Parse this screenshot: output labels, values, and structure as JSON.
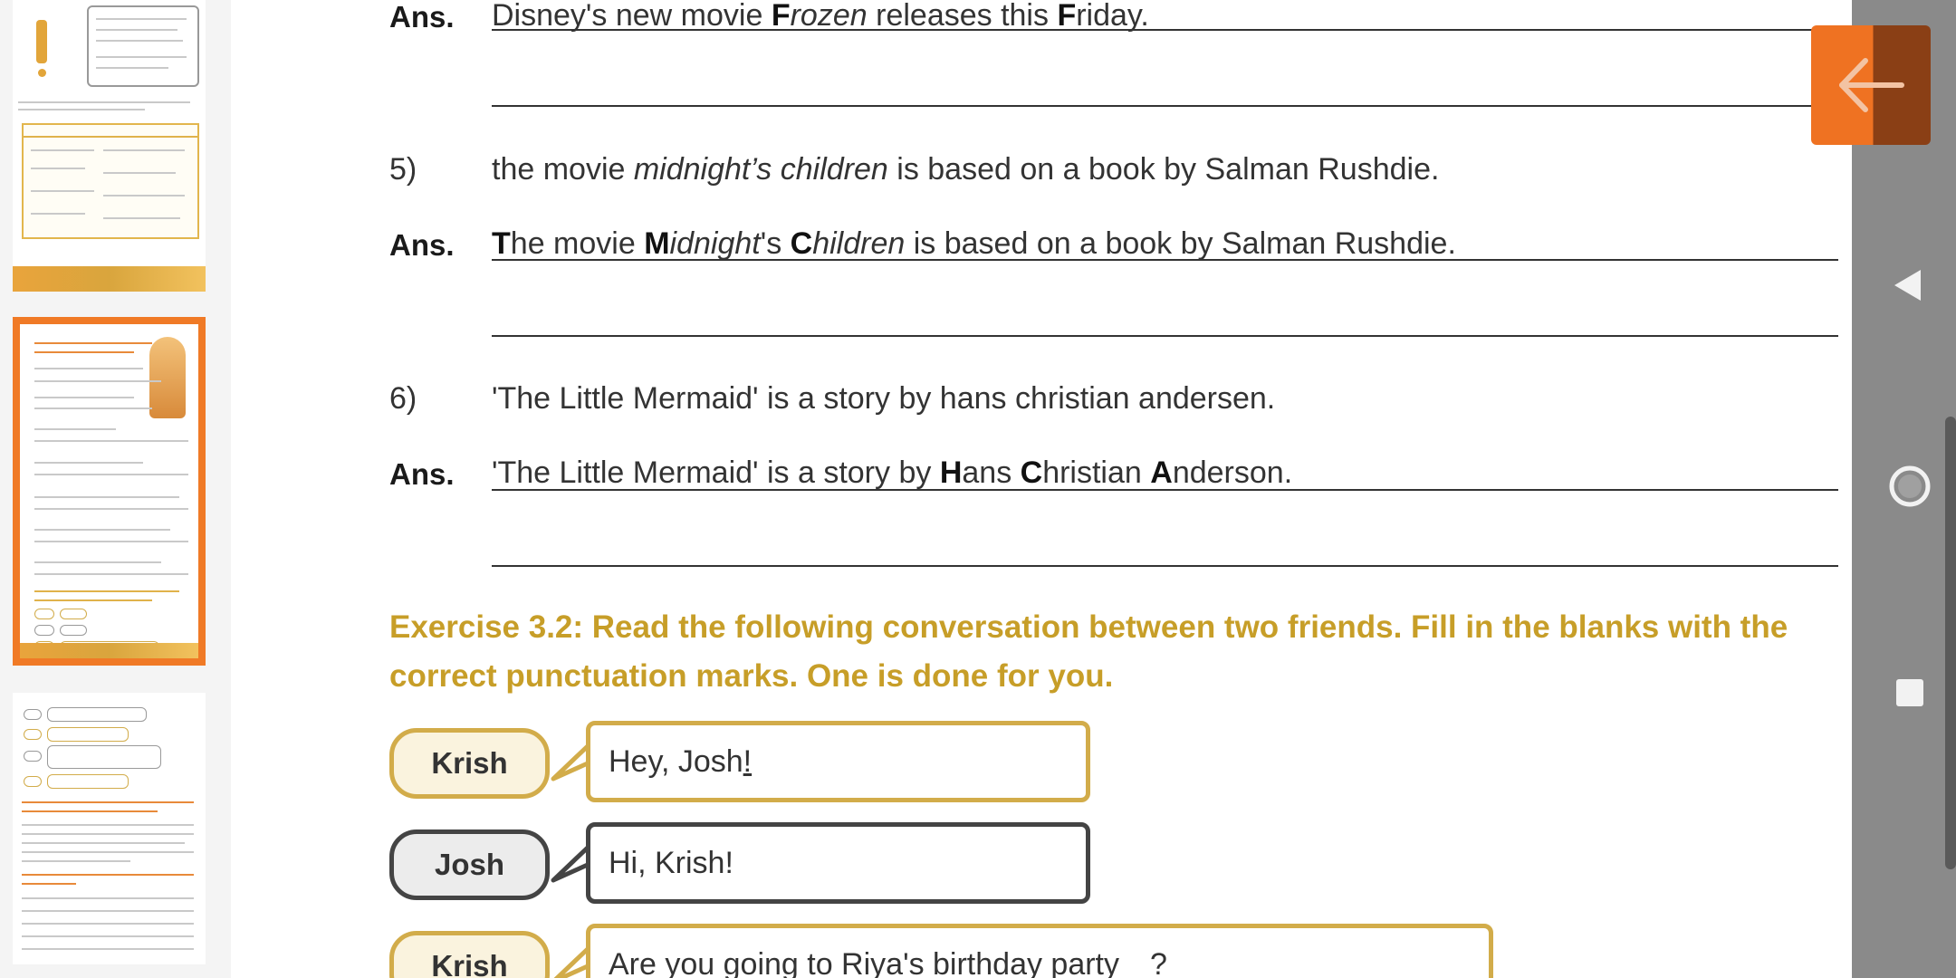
{
  "questions": {
    "q4_answer": {
      "label": "Ans.",
      "p1": "Disney's new movie ",
      "b1": "F",
      "i1": "rozen",
      "p2": " releases this ",
      "b2": "F",
      "p3": "riday."
    },
    "q5": {
      "number": "5)",
      "q_p1": "the movie ",
      "q_i1": "midnight’s children",
      "q_p2": " is based on a book by Salman Rushdie.",
      "ans_label": "Ans.",
      "a_b1": "T",
      "a_p1": "he movie ",
      "a_b2": "M",
      "a_i1": "idnight",
      "a_p2": "'s ",
      "a_b3": "C",
      "a_i2": "hildren",
      "a_p3": " is based on a book by Salman Rushdie."
    },
    "q6": {
      "number": "6)",
      "question": "'The Little Mermaid' is a story by hans christian andersen.",
      "ans_label": "Ans.",
      "a_p1": "'The Little Mermaid' is a story by ",
      "a_b1": "H",
      "a_p2": "ans ",
      "a_b2": "C",
      "a_p3": "hristian ",
      "a_b3": "A",
      "a_p4": "nderson."
    }
  },
  "exercise": {
    "title": "Exercise 3.2: Read the following conversation between two friends. Fill in the blanks with the correct punctuation marks. One is done for you."
  },
  "conversation": [
    {
      "speaker": "Krish",
      "text": "Hey, Josh",
      "answer": "!"
    },
    {
      "speaker": "Josh",
      "text": "Hi, Krish!"
    },
    {
      "speaker": "Krish",
      "text": "Are you going to Riya's birthday party",
      "blank": "_",
      "end": "?"
    }
  ],
  "nav": {
    "back_icon": "arrow-left-icon",
    "back_color": "#ef7222",
    "android_back_icon": "triangle-back-icon",
    "home_icon": "circle-home-icon",
    "recents_icon": "square-recents-icon"
  },
  "colors": {
    "accent": "#c79e28",
    "thumb_active_border": "#f07a26"
  }
}
